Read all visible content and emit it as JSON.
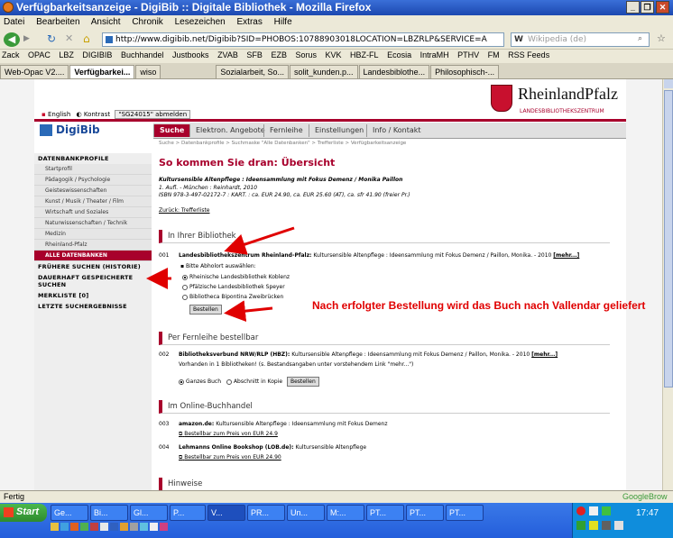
{
  "window": {
    "title": "Verfügbarkeitsanzeige - DigiBib :: Digitale Bibliothek - Mozilla Firefox"
  },
  "menu": [
    "Datei",
    "Bearbeiten",
    "Ansicht",
    "Chronik",
    "Lesezeichen",
    "Extras",
    "Hilfe"
  ],
  "nav": {
    "url": "http://www.digibib.net/Digibib?SID=PHOBOS:10788903018LOCATION=LBZRLP&SERVICE=A",
    "search_placeholder": "Wikipedia (de)"
  },
  "bookmarks": [
    "Zack",
    "OPAC",
    "LBZ",
    "DIGIBIB",
    "Buchhandel",
    "Justbooks",
    "ZVAB",
    "SFB",
    "EZB",
    "Sorus",
    "KVK",
    "HBZ-FL",
    "Ecosia",
    "IntraMH",
    "PTHV",
    "FM",
    "RSS Feeds"
  ],
  "tabs": [
    {
      "label": "Web-Opac V2....",
      "active": false
    },
    {
      "label": "Verfügbarkei...",
      "active": true
    },
    {
      "label": "wiso",
      "active": false
    },
    {
      "label": "Sozialarbeit, So...",
      "active": false
    },
    {
      "label": "solit_kunden.p...",
      "active": false
    },
    {
      "label": "Landesbiblothe...",
      "active": false
    },
    {
      "label": "Philosophisch-...",
      "active": false
    }
  ],
  "site": {
    "logo_text": "RheinlandPfalz",
    "logo_sub": "LANDESBIBLIOTHEKSZENTRUM",
    "lang_en": "English",
    "lang_kontrast": "Kontrast",
    "login_btn": "\"SG24015\" abmelden",
    "digibib": "DigiBib",
    "top_tabs": [
      "Suche",
      "Elektron. Angebote",
      "Fernleihe",
      "Einstellungen",
      "Info / Kontakt"
    ],
    "breadcrumb": "Suche > Datenbankprofile > Suchmaske \"Alle Datenbanken\" > Trefferliste > Verfügbarkeitsanzeige"
  },
  "sidebar": {
    "profile_head": "DATENBANKPROFILE",
    "items": [
      "Startprofil",
      "Pädagogik / Psychologie",
      "Geisteswissenschaften",
      "Kunst / Musik / Theater / Film",
      "Wirtschaft und Soziales",
      "Naturwissenschaften / Technik",
      "Medizin",
      "Rheinland-Pfalz"
    ],
    "active_item": "ALLE DATENBANKEN",
    "links": [
      "FRÜHERE SUCHEN (HISTORIE)",
      "DAUERHAFT GESPEICHERTE SUCHEN",
      "MERKLISTE [0]",
      "LETZTE SUCHERGEBNISSE"
    ]
  },
  "main": {
    "heading": "So kommen Sie dran: Übersicht",
    "book_title": "Kultursensible Altenpflege : Ideensammlung mit Fokus Demenz / Monika Paillon",
    "book_line2": "1. Aufl. - München : Reinhardt, 2010",
    "book_line3": "ISBN 978-3-497-02172-7 : KART. : ca. EUR 24.90, ca. EUR 25.60 (AT), ca. sfr 41.90 (freier Pr.)",
    "back_link": "Zurück: Trefferliste",
    "sec1": "In Ihrer Bibliothek",
    "sec1_num": "001",
    "sec1_entry_bold": "Landesbibliothekszentrum Rheinland-Pfalz:",
    "sec1_entry": "Kultursensible Altenpflege : Ideensammlung mit Fokus Demenz / Paillon, Monika. - 2010",
    "mehr": "[mehr...]",
    "choose": "Bitte Abholort auswählen:",
    "options": [
      "Rheinische Landesbibliothek Koblenz",
      "Pfälzische Landesbibliothek Speyer",
      "Bibliotheca Bipontina Zweibrücken"
    ],
    "order_btn": "Bestellen",
    "note": "Nach erfolgter Bestellung wird das Buch nach Vallendar geliefert",
    "sec2": "Per Fernleihe bestellbar",
    "sec2_num": "002",
    "sec2_entry_bold": "Bibliotheksverbund NRW/RLP (HBZ):",
    "sec2_entry": "Kultursensible Altenpflege : Ideensammlung mit Fokus Demenz / Paillon, Monika. - 2010",
    "sec2_line2": "Vorhanden in 1 Bibliotheken! (s. Bestandsangaben unter vorstehendem Link \"mehr...\")",
    "sec2_opt1": "Ganzes Buch",
    "sec2_opt2": "Abschnitt in Kopie",
    "sec2_btn": "Bestellen",
    "sec3": "Im Online-Buchhandel",
    "sec3_items": [
      {
        "num": "003",
        "bold": "amazon.de:",
        "text": "Kultursensible Altenpflege : Ideensammlung mit Fokus Demenz",
        "link": "Bestellbar zum Preis von EUR 24.9"
      },
      {
        "num": "004",
        "bold": "Lehmanns Online Bookshop (LOB.de):",
        "text": "Kultursensible Altenpflege",
        "link": "Bestellbar zum Preis von EUR 24.90"
      }
    ],
    "sec4": "Hinweise"
  },
  "status": {
    "text": "Fertig",
    "right": "GoogleBrow"
  },
  "taskbar": {
    "start": "Start",
    "buttons": [
      "Ge...",
      "Bi...",
      "Gl...",
      "P...",
      "V...",
      "PR...",
      "Un...",
      "M:...",
      "PT...",
      "PT...",
      "PT..."
    ],
    "clock": "17:47"
  },
  "colors": {
    "accent": "#a8002c",
    "note": "#e00000"
  }
}
